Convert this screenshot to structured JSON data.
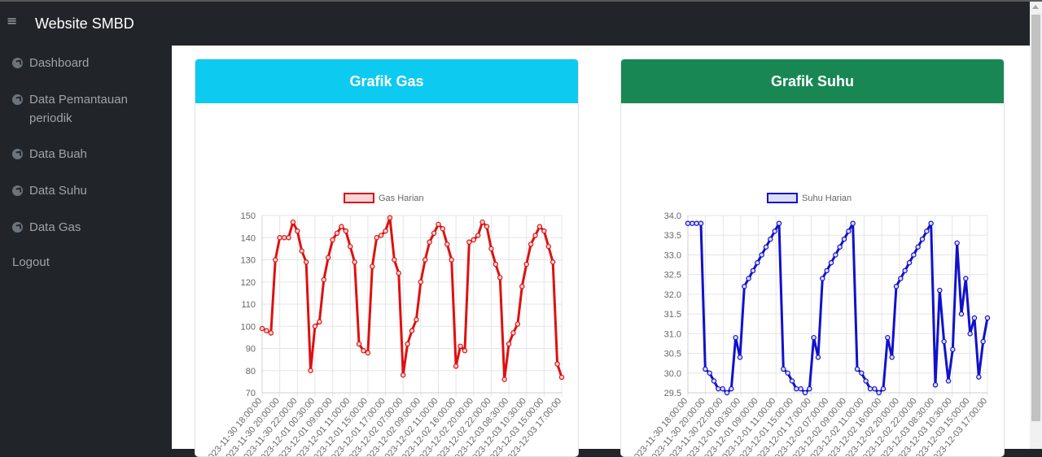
{
  "app": {
    "title": "Website SMBD"
  },
  "sidebar": {
    "items": [
      {
        "label": "Dashboard",
        "icon": "tachometer-icon"
      },
      {
        "label": "Data Pemantauan periodik",
        "icon": "tachometer-icon"
      },
      {
        "label": "Data Buah",
        "icon": "tachometer-icon"
      },
      {
        "label": "Data Suhu",
        "icon": "tachometer-icon"
      },
      {
        "label": "Data Gas",
        "icon": "tachometer-icon"
      }
    ],
    "logout": "Logout"
  },
  "colors": {
    "gas_header": "#0dcaf0",
    "suhu_header": "#198754",
    "gas_line": "#dd1111",
    "suhu_line": "#1111cc"
  },
  "chart_data": [
    {
      "type": "line",
      "card_title": "Grafik Gas",
      "series": [
        {
          "name": "Gas Harian",
          "values": [
            99,
            98,
            97,
            130,
            140,
            140,
            140,
            147,
            143,
            134,
            129,
            80,
            100,
            102,
            121,
            131,
            139,
            142,
            145,
            143,
            136,
            129,
            92,
            89,
            88,
            127,
            140,
            141,
            143,
            149,
            130,
            124,
            78,
            92,
            98,
            103,
            120,
            130,
            138,
            142,
            146,
            144,
            137,
            130,
            82,
            91,
            89,
            138,
            139,
            141,
            147,
            145,
            135,
            128,
            122,
            76,
            92,
            97,
            101,
            118,
            128,
            137,
            141,
            145,
            143,
            136,
            129,
            83,
            77
          ]
        }
      ],
      "x_labels": [
        "2023-11-30 18:00:00",
        "2023-11-30 20:00:00",
        "2023-11-30 22:00:00",
        "2023-12-01 00:30:00",
        "2023-12-01 09:00:00",
        "2023-12-01 11:00:00",
        "2023-12-01 15:00:00",
        "2023-12-01 17:00:00",
        "2023-12-02 07:00:00",
        "2023-12-02 09:00:00",
        "2023-12-02 11:00:00",
        "2023-12-02 16:00:00",
        "2023-12-02 20:00:00",
        "2023-12-02 22:00:00",
        "2023-12-03 08:30:00",
        "2023-12-03 10:30:00",
        "2023-12-03 15:00:00",
        "2023-12-03 17:00:00"
      ],
      "y_ticks": [
        "150",
        "140",
        "130",
        "120",
        "110",
        "100",
        "90",
        "80",
        "70"
      ],
      "ylim": [
        70,
        150
      ],
      "grid": true,
      "legend": "top"
    },
    {
      "type": "line",
      "card_title": "Grafik Suhu",
      "series": [
        {
          "name": "Suhu Harian",
          "values": [
            33.8,
            33.8,
            33.8,
            33.8,
            30.1,
            30.0,
            29.8,
            29.6,
            29.6,
            29.5,
            29.6,
            30.9,
            30.4,
            32.2,
            32.4,
            32.6,
            32.8,
            33.0,
            33.2,
            33.4,
            33.6,
            33.8,
            30.1,
            30.0,
            29.8,
            29.6,
            29.6,
            29.5,
            29.6,
            30.9,
            30.4,
            32.4,
            32.6,
            32.8,
            33.0,
            33.2,
            33.4,
            33.6,
            33.8,
            30.1,
            30.0,
            29.8,
            29.6,
            29.6,
            29.5,
            29.6,
            30.9,
            30.4,
            32.2,
            32.4,
            32.6,
            32.8,
            33.0,
            33.2,
            33.4,
            33.6,
            33.8,
            29.7,
            32.1,
            30.8,
            29.8,
            30.6,
            33.3,
            31.5,
            32.4,
            31.0,
            31.4,
            29.9,
            30.8,
            31.4
          ]
        }
      ],
      "x_labels": [
        "2023-11-30 18:00:00",
        "2023-11-30 20:00:00",
        "2023-11-30 22:00:00",
        "2023-12-01 00:30:00",
        "2023-12-01 09:00:00",
        "2023-12-01 11:00:00",
        "2023-12-01 15:00:00",
        "2023-12-01 17:00:00",
        "2023-12-02 07:00:00",
        "2023-12-02 09:00:00",
        "2023-12-02 11:00:00",
        "2023-12-02 16:00:00",
        "2023-12-02 20:00:00",
        "2023-12-02 22:00:00",
        "2023-12-03 08:30:00",
        "2023-12-03 10:30:00",
        "2023-12-03 15:00:00",
        "2023-12-03 17:00:00"
      ],
      "y_ticks": [
        "34.0",
        "33.5",
        "33.0",
        "32.5",
        "32.0",
        "31.5",
        "31.0",
        "30.5",
        "30.0",
        "29.5"
      ],
      "ylim": [
        29.5,
        34.0
      ],
      "grid": true,
      "legend": "top"
    }
  ]
}
